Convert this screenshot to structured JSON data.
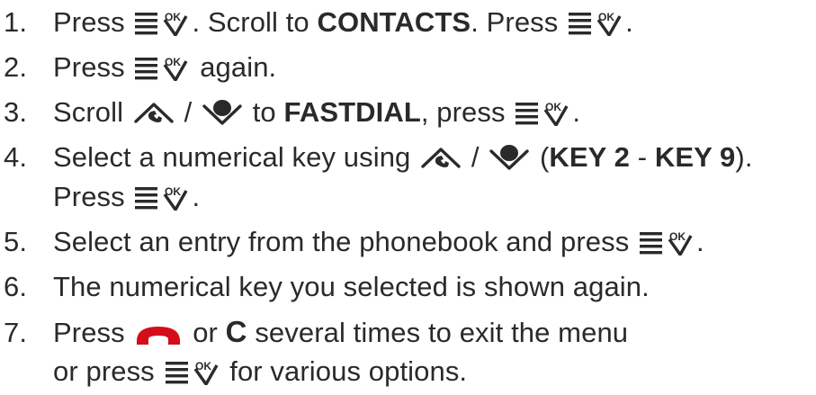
{
  "steps": [
    {
      "number": "1.",
      "parts": [
        "Press",
        ". Scroll to",
        "CONTACTS",
        ". Press",
        "."
      ]
    },
    {
      "number": "2.",
      "parts": [
        "Press",
        "again."
      ]
    },
    {
      "number": "3.",
      "parts": [
        "Scroll",
        "/",
        "to",
        "FASTDIAL",
        ", press",
        "."
      ]
    },
    {
      "number": "4.",
      "parts": [
        "Select a numerical key using",
        "/",
        "(",
        "KEY 2",
        "-",
        "KEY 9",
        ")."
      ],
      "continuation": [
        "Press",
        "."
      ]
    },
    {
      "number": "5.",
      "parts": [
        "Select an entry from the phonebook and press",
        "."
      ]
    },
    {
      "number": "6.",
      "parts": [
        "The numerical key you selected is shown again."
      ]
    },
    {
      "number": "7.",
      "parts": [
        "Press",
        "or",
        "C",
        "several times to exit the menu"
      ],
      "continuation": [
        "or press",
        "for various options."
      ]
    }
  ],
  "icons": {
    "menu_ok": "menu-ok-key-icon",
    "scroll_up": "scroll-up-key-icon",
    "scroll_down": "scroll-down-key-icon",
    "end_call": "end-call-key-icon"
  },
  "colors": {
    "text": "#2a2a2a",
    "end_call_red": "#d50d1a"
  }
}
